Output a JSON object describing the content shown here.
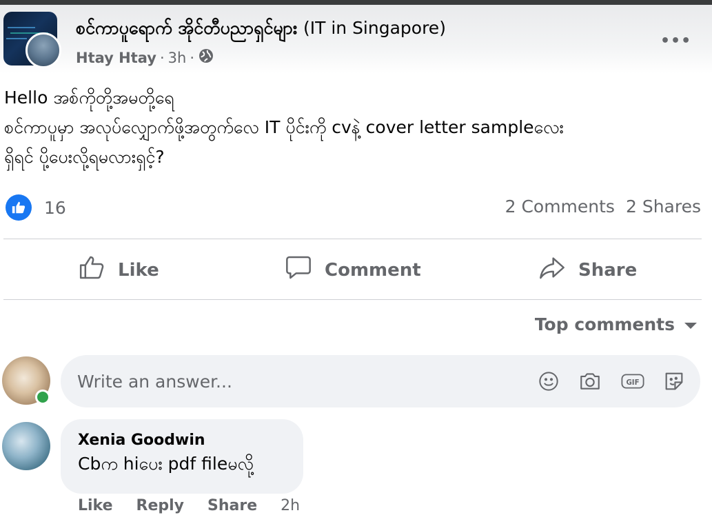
{
  "post": {
    "group_name_mm": "စင်ကာပူရောက် အိုင်တီပညာရှင်များ",
    "group_name_en": "(IT in Singapore)",
    "author": "Htay Htay",
    "time": "3h",
    "separator": "·",
    "audience_icon": "globe-icon",
    "more_label": "•••",
    "lines": [
      "Hello အစ်ကိုတို့အမတို့ရေ",
      "စင်ကာပူမှာ အလုပ်လျှောက်ဖို့အတွက်လေ IT ပိုင်းကို cvနဲ့ cover letter sampleလေး",
      "ရှိရင် ပို့ပေးလို့ရမလားရှင့်?"
    ]
  },
  "reactions": {
    "icon": "like-icon",
    "count": "16",
    "comments": "2 Comments",
    "shares": "2 Shares"
  },
  "actions": {
    "like": "Like",
    "comment": "Comment",
    "share": "Share"
  },
  "sort": {
    "label": "Top comments"
  },
  "composer": {
    "placeholder": "Write an answer...",
    "icons": [
      "emoji-icon",
      "camera-icon",
      "gif-icon",
      "sticker-icon"
    ]
  },
  "comments": [
    {
      "name": "Xenia Goodwin",
      "text": "Cbက hiပေး pdf fileမလို့",
      "like": "Like",
      "reply": "Reply",
      "share": "Share",
      "time": "2h"
    }
  ],
  "colors": {
    "accent": "#1877f2",
    "secondary_text": "#65676b",
    "bubble": "#f0f2f5",
    "online": "#31a24c"
  }
}
